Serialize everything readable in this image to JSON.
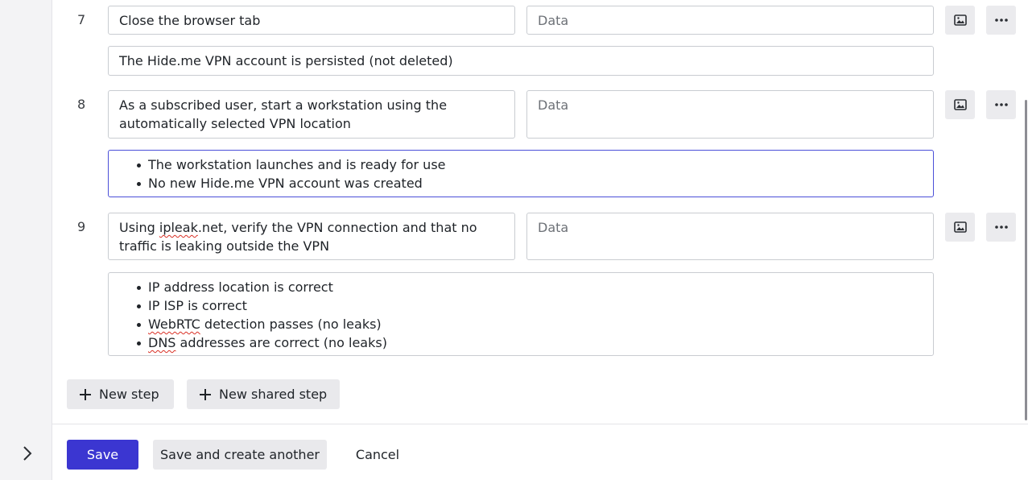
{
  "steps": [
    {
      "number": "7",
      "action": "Close the browser tab",
      "data_placeholder": "Data",
      "expected_text": "The Hide.me VPN account is persisted (not deleted)"
    },
    {
      "number": "8",
      "action": "As a subscribed user, start a workstation using the automatically selected VPN location",
      "data_placeholder": "Data",
      "expected": [
        "The workstation launches and is ready for use",
        "No new Hide.me VPN account was created"
      ]
    },
    {
      "number": "9",
      "action_parts": [
        "Using ",
        "ipleak",
        ".net, verify the VPN connection and that no traffic is leaking outside the VPN"
      ],
      "data_placeholder": "Data",
      "expected": [
        "IP address location is correct",
        "IP ISP is correct",
        [
          "WebRTC",
          " detection passes (no leaks)"
        ],
        [
          "DNS",
          " addresses are correct (no leaks)"
        ]
      ]
    }
  ],
  "icons": {
    "image": "image-icon",
    "more": "more-horizontal-icon",
    "plus": "plus-icon",
    "expand": "chevron-right-icon"
  },
  "actions": {
    "new_step": "New step",
    "new_shared_step": "New shared step"
  },
  "footer": {
    "save": "Save",
    "save_and_create_another": "Save and create another",
    "cancel": "Cancel"
  },
  "colors": {
    "primary": "#3b36d1",
    "focus_border": "#4a4fd8",
    "spell_error": "#d93025"
  }
}
